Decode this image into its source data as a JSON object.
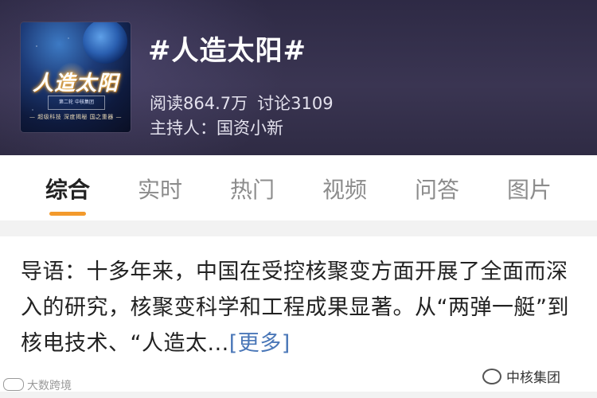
{
  "topic": {
    "title": "#人造太阳#",
    "reads": "阅读864.7万",
    "discussions": "讨论3109",
    "host": "主持人：国资小新",
    "cover": {
      "title": "人造太阳",
      "box_text": "第二轮 中核集团",
      "subtitle": "— 超级科技 深度揭秘 国之重器 —"
    }
  },
  "tabs": [
    {
      "label": "综合",
      "active": true
    },
    {
      "label": "实时",
      "active": false
    },
    {
      "label": "热门",
      "active": false
    },
    {
      "label": "视频",
      "active": false
    },
    {
      "label": "问答",
      "active": false
    },
    {
      "label": "图片",
      "active": false
    }
  ],
  "intro": {
    "text": "导语：十多年来，中国在受控核聚变方面开展了全面而深入的研究，核聚变科学和工程成果显著。从“两弹一艇”到核电技术、“人造太...",
    "more": "[更多]"
  },
  "watermarks": {
    "left": "大数跨境",
    "right": "中核集团"
  },
  "colors": {
    "tab_indicator": "#f39a2c",
    "link": "#4a77b8",
    "header_bg": "#2e2a45"
  }
}
